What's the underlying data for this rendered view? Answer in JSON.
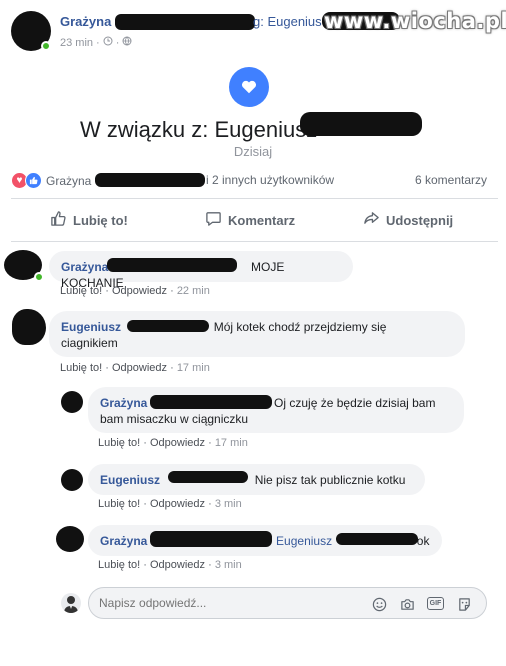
{
  "header": {
    "author_first": "Grażyna",
    "rest_visible": "g: Eugenius",
    "time": "23 min",
    "time_sep": "·",
    "watermark": "www.wiocha.pl"
  },
  "life_event": {
    "title": "W związku z: Eugeniusz",
    "date": "Dzisiaj"
  },
  "reactions": {
    "names_first": "Grażyna",
    "others": "i 2 innych użytkowników",
    "comments": "6 komentarzy"
  },
  "actions": {
    "like": "Lubię to!",
    "comment": "Komentarz",
    "share": "Udostępnij"
  },
  "comments": [
    {
      "name": "Grażyna",
      "text": "MOJE KOCHANIE",
      "like": "Lubię to!",
      "reply": "Odpowiedz",
      "time": "22 min"
    },
    {
      "name": "Eugeniusz",
      "text": "Mój kotek chodź przejdziemy się",
      "text2": "ciagnikiem",
      "like": "Lubię to!",
      "reply": "Odpowiedz",
      "time": "17 min"
    },
    {
      "name": "Grażyna",
      "text": "Oj czuję że będzie dzisiaj bam",
      "text2": "bam misaczku w ciągniczku",
      "like": "Lubię to!",
      "reply": "Odpowiedz",
      "time": "17 min"
    },
    {
      "name": "Eugeniusz",
      "text": "Nie pisz tak publicznie kotku",
      "like": "Lubię to!",
      "reply": "Odpowiedz",
      "time": "3 min"
    },
    {
      "name": "Grażyna",
      "mention": "Eugeniusz",
      "text": "ok",
      "like": "Lubię to!",
      "reply": "Odpowiedz",
      "time": "3 min"
    }
  ],
  "reply_box": {
    "placeholder": "Napisz odpowiedź..."
  },
  "colors": {
    "link": "#365899",
    "accent": "#4080ff",
    "love": "#f25268",
    "online": "#42b72a"
  },
  "icons": [
    "heart-icon",
    "like-icon",
    "thumb-up-icon",
    "comment-icon",
    "share-icon",
    "emoji-icon",
    "camera-icon",
    "gif-icon",
    "sticker-icon",
    "clock-icon",
    "globe-icon"
  ]
}
